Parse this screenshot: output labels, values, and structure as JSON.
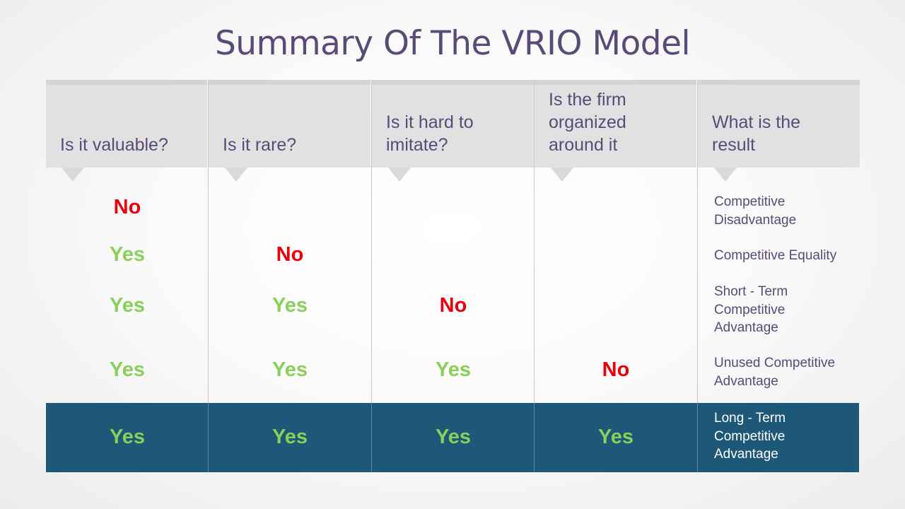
{
  "title": "Summary Of  The VRIO Model",
  "colors": {
    "title": "#5a4a78",
    "yes": "#8acf5a",
    "no": "#e8000b",
    "highlight_row": "#1e5878",
    "header_bg": "#e1e1e1"
  },
  "headers": [
    "Is it valuable?",
    "Is it rare?",
    "Is it hard to imitate?",
    "Is the firm organized around it",
    "What is the result"
  ],
  "rows": [
    {
      "answers": [
        "No",
        "",
        "",
        ""
      ],
      "result": "Competitive Disadvantage"
    },
    {
      "answers": [
        "Yes",
        "No",
        "",
        ""
      ],
      "result": "Competitive Equality"
    },
    {
      "answers": [
        "Yes",
        "Yes",
        "No",
        ""
      ],
      "result": "Short - Term Competitive Advantage"
    },
    {
      "answers": [
        "Yes",
        "Yes",
        "Yes",
        "No"
      ],
      "result": "Unused Competitive Advantage"
    },
    {
      "answers": [
        "Yes",
        "Yes",
        "Yes",
        "Yes"
      ],
      "result": "Long - Term Competitive Advantage",
      "highlighted": true
    }
  ]
}
